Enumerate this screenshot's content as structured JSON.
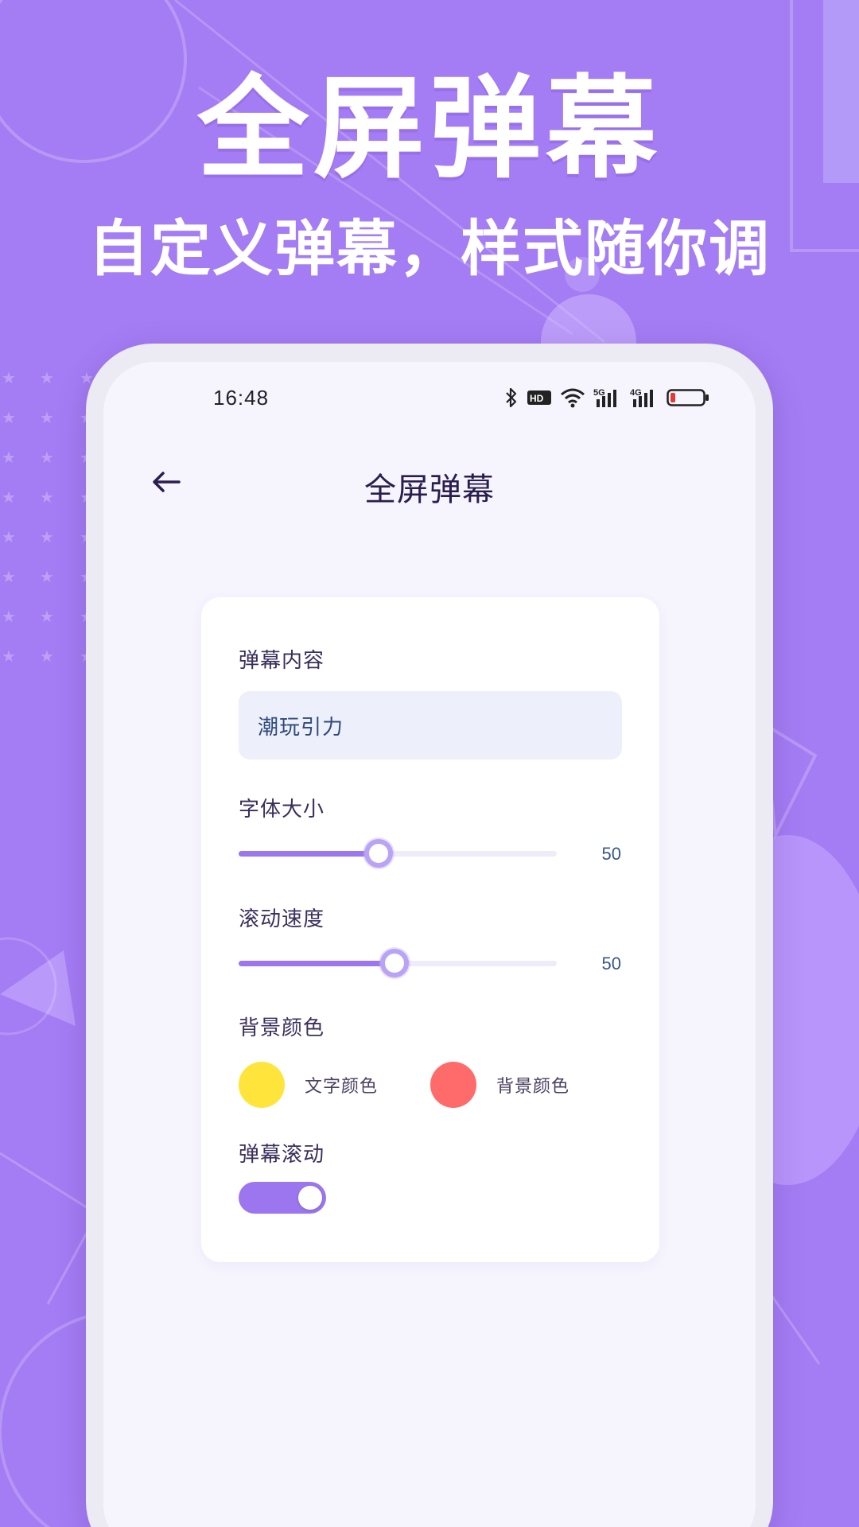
{
  "promo": {
    "title": "全屏弹幕",
    "subtitle": "自定义弹幕，样式随你调"
  },
  "status_bar": {
    "time": "16:48",
    "icons": [
      "bluetooth-icon",
      "hd-icon",
      "wifi-icon",
      "signal-5g-icon",
      "signal-4g-icon",
      "battery-icon"
    ],
    "battery_level": 0.15
  },
  "header": {
    "back_icon": "arrow-left-icon",
    "title": "全屏弹幕"
  },
  "settings": {
    "content": {
      "label": "弹幕内容",
      "value": "潮玩引力"
    },
    "font_size": {
      "label": "字体大小",
      "value": 50,
      "value_text": "50",
      "fill_fraction": 0.44
    },
    "scroll_speed": {
      "label": "滚动速度",
      "value": 50,
      "value_text": "50",
      "fill_fraction": 0.49
    },
    "background": {
      "label": "背景颜色",
      "options": [
        {
          "label": "文字颜色",
          "color": "#FFE53B"
        },
        {
          "label": "背景颜色",
          "color": "#FF6B6B"
        }
      ]
    },
    "scrolling": {
      "label": "弹幕滚动",
      "enabled": true
    }
  },
  "colors": {
    "page_bg": "#A47CF3",
    "accent": "#9B76EE",
    "title_text": "#2A1E4E"
  }
}
